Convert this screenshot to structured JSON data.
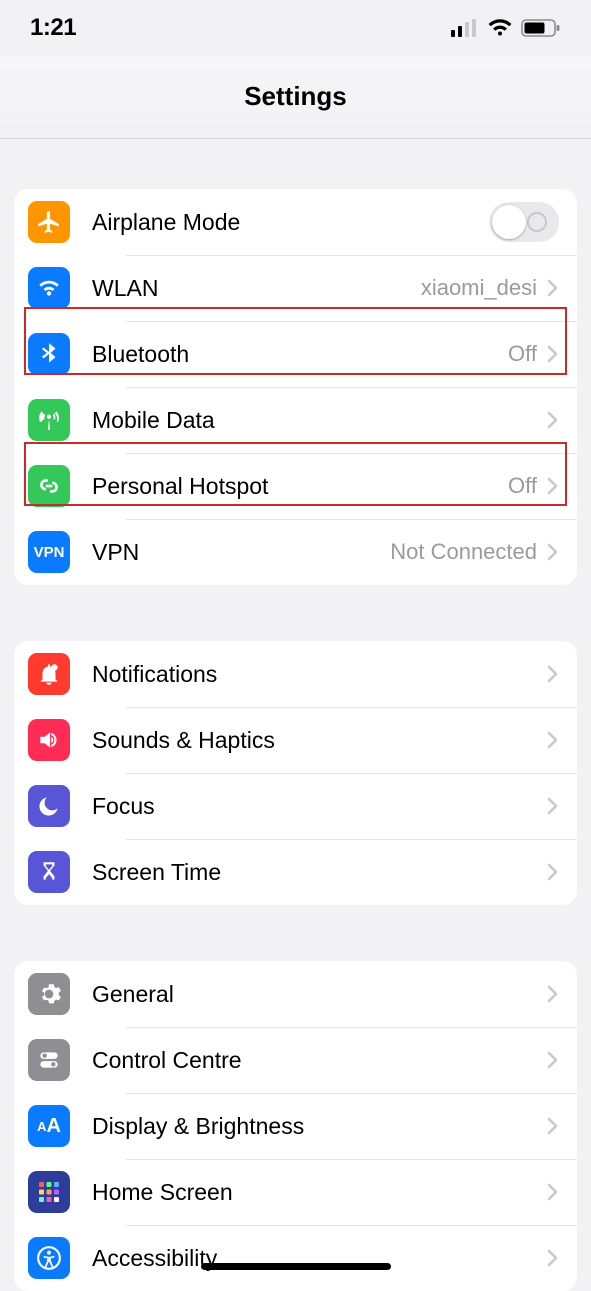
{
  "status": {
    "time": "1:21"
  },
  "header": {
    "title": "Settings"
  },
  "group1": {
    "airplane": {
      "label": "Airplane Mode",
      "on": false
    },
    "wlan": {
      "label": "WLAN",
      "value": "xiaomi_desi"
    },
    "bluetooth": {
      "label": "Bluetooth",
      "value": "Off"
    },
    "mobile_data": {
      "label": "Mobile Data"
    },
    "hotspot": {
      "label": "Personal Hotspot",
      "value": "Off"
    },
    "vpn": {
      "label": "VPN",
      "value": "Not Connected",
      "badge": "VPN"
    }
  },
  "group2": {
    "notifications": {
      "label": "Notifications"
    },
    "sounds": {
      "label": "Sounds & Haptics"
    },
    "focus": {
      "label": "Focus"
    },
    "screentime": {
      "label": "Screen Time"
    }
  },
  "group3": {
    "general": {
      "label": "General"
    },
    "controlcentre": {
      "label": "Control Centre"
    },
    "display": {
      "label": "Display & Brightness"
    },
    "homescreen": {
      "label": "Home Screen"
    },
    "accessibility": {
      "label": "Accessibility"
    }
  }
}
